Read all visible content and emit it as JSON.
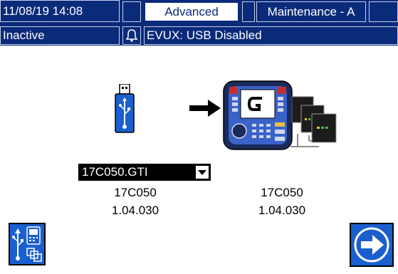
{
  "header": {
    "datetime": "11/08/19 14:08",
    "tab_advanced": "Advanced",
    "tab_maintenance": "Maintenance - A",
    "status": "Inactive",
    "message": "EVUX: USB Disabled"
  },
  "icons": {
    "bell": "bell-icon",
    "usb": "usb-drive-icon",
    "arrow": "right-arrow-icon",
    "display": "advanced-display-module-icon",
    "modules": "component-modules-icon",
    "usb_update": "usb-update-icon",
    "next": "next-arrow-icon"
  },
  "source": {
    "file_select": "17C050.GTI",
    "part": "17C050",
    "version": "1.04.030"
  },
  "target": {
    "part": "17C050",
    "version": "1.04.030"
  },
  "colors": {
    "navy": "#0a2a7a",
    "accent_blue": "#1a5fd0"
  }
}
